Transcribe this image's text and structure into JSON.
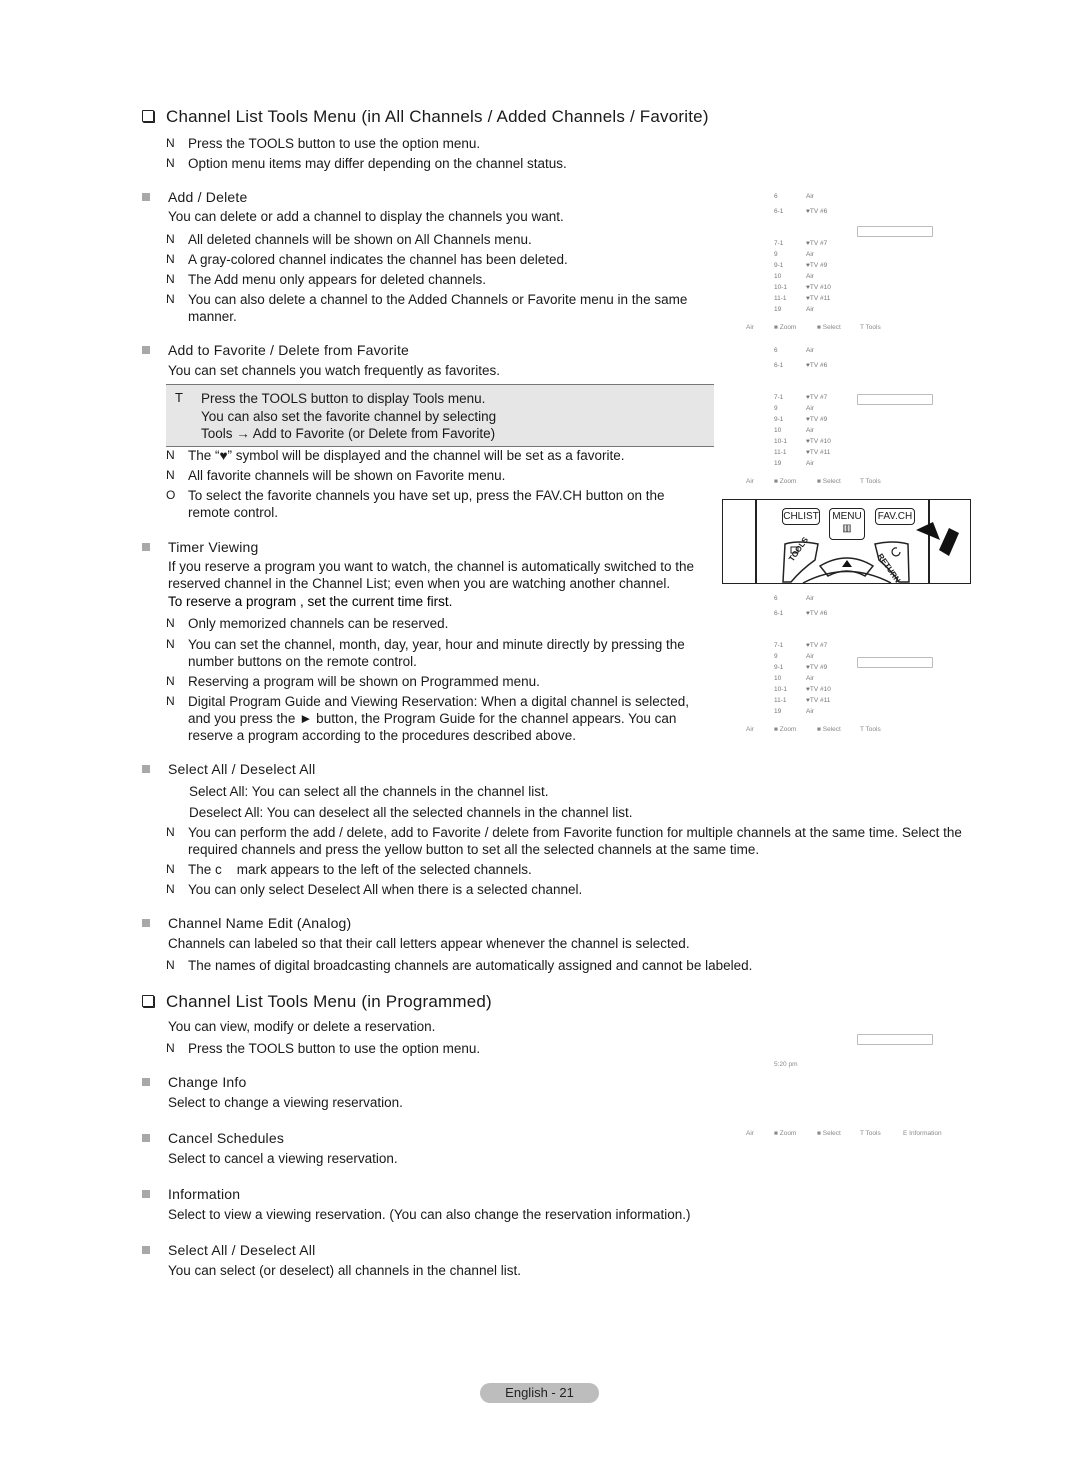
{
  "section1": {
    "title": "Channel List Tools Menu (in All Channels / Added Channels / Favorite)",
    "notes": [
      "Press the TOOLS button to use the option menu.",
      "Option menu items may differ depending on the channel status."
    ]
  },
  "add_delete": {
    "heading": "Add / Delete",
    "body": "You can delete or add a channel to display the channels you want.",
    "notes": [
      "All deleted channels will be shown on All Channels menu.",
      "A gray-colored channel indicates the channel has been deleted.",
      "The Add menu only appears for deleted channels.",
      "You can also delete a channel to the Added Channels or Favorite menu in the same manner."
    ]
  },
  "favorite": {
    "heading": "Add to Favorite / Delete from Favorite",
    "body": "You can set channels you watch frequently as favorites.",
    "tip_marker": "T",
    "tip_lines": [
      "Press the TOOLS button to display Tools menu.",
      "You can also set the favorite channel by selecting",
      "Tools → Add to Favorite (or Delete from Favorite)"
    ],
    "notes": [
      {
        "marker": "N",
        "text": "The “♥” symbol will be displayed and the channel will be set as a favorite."
      },
      {
        "marker": "N",
        "text": "All favorite channels will be shown on Favorite menu."
      },
      {
        "marker": "O",
        "text": "To select the favorite channels you have set up, press the FAV.CH button on the remote control."
      }
    ]
  },
  "timer": {
    "heading": "Timer Viewing",
    "body": "If you reserve a program you want to watch, the channel is automatically switched to the reserved channel in the Channel List; even when you are watching another channel.",
    "body_bold": "To reserve a program , set the current time first.",
    "notes": [
      "Only memorized channels can be reserved.",
      "You can set the channel, month, day, year, hour and minute directly by pressing the number buttons on the remote control.",
      "Reserving a program will be shown on Programmed menu.",
      "Digital Program Guide and Viewing Reservation: When a digital channel is selected, and you press the ► button, the Program Guide for the channel appears. You can reserve a program according to the procedures described above."
    ]
  },
  "select_all": {
    "heading": "Select All / Deselect All",
    "lines": [
      "Select All: You can select all the channels in the channel list.",
      "Deselect All: You can deselect all the selected channels in the channel list."
    ],
    "notes": [
      "You can perform the add / delete, add to Favorite / delete from Favorite function for multiple channels at the same time. Select the required channels and press the yellow button to set all the selected channels at the same time.",
      "The c    mark appears to the left of the selected channels.",
      "You can only select Deselect All when there is a selected channel."
    ]
  },
  "name_edit": {
    "heading": "Channel Name Edit (Analog)",
    "body": "Channels can labeled so that their call letters appear whenever the channel is selected.",
    "notes": [
      "The names of digital broadcasting channels are automatically assigned and cannot be labeled."
    ]
  },
  "section2": {
    "title": "Channel List Tools Menu (in Programmed)",
    "body": "You can view, modify or delete a reservation.",
    "notes": [
      "Press the TOOLS button to use the option menu."
    ],
    "items": [
      {
        "heading": "Change Info",
        "body": "Select to change a viewing reservation."
      },
      {
        "heading": "Cancel Schedules",
        "body": "Select to cancel a viewing reservation."
      },
      {
        "heading": "Information",
        "body": "Select to view a viewing reservation. (You can also change the reservation information.)"
      },
      {
        "heading": "Select All / Deselect All",
        "body": "You can select (or deselect) all channels in the channel list."
      }
    ]
  },
  "note_marker": "N",
  "osd": {
    "channels": [
      {
        "num": "6",
        "name": "Air"
      },
      {
        "num": "6-1",
        "name": "♥TV #6"
      },
      {
        "num": "7-1",
        "name": "♥TV #7"
      },
      {
        "num": "9",
        "name": "Air"
      },
      {
        "num": "9-1",
        "name": "♥TV #9"
      },
      {
        "num": "10",
        "name": "Air"
      },
      {
        "num": "10-1",
        "name": "♥TV #10"
      },
      {
        "num": "11-1",
        "name": "♥TV #11"
      },
      {
        "num": "19",
        "name": "Air"
      }
    ],
    "legend": [
      "Air",
      "■ Zoom",
      "■ Select",
      "T  Tools"
    ],
    "programmed_time": "5:20 pm",
    "programmed_legend": [
      "Air",
      "■ Zoom",
      "■ Select",
      "T  Tools",
      "E  Information"
    ]
  },
  "remote": {
    "buttons": [
      "CHLIST",
      "MENU",
      "FAV.CH"
    ],
    "menu_icon": "▥",
    "tools_label": "TOOLS",
    "return_label": "RETURN",
    "up_arrow": "▲"
  },
  "footer": {
    "page_label": "English - 21"
  }
}
